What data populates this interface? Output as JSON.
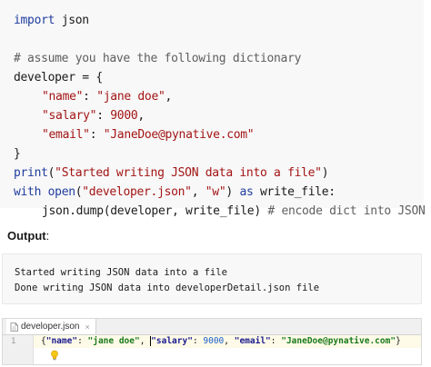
{
  "code": {
    "line1": {
      "kw": "import",
      "rest": " json"
    },
    "line3": "# assume you have the following dictionary",
    "line4": {
      "var": "developer",
      "op": " = {"
    },
    "line5": {
      "key": "\"name\"",
      "sep": ": ",
      "val": "\"jane doe\"",
      "end": ","
    },
    "line6": {
      "key": "\"salary\"",
      "sep": ": ",
      "val": "9000",
      "end": ","
    },
    "line7": {
      "key": "\"email\"",
      "sep": ": ",
      "val": "\"JaneDoe@pynative.com\""
    },
    "line8": "}",
    "line9": {
      "fn": "print",
      "open": "(",
      "str": "\"Started writing JSON data into a file\"",
      "close": ")"
    },
    "line10": {
      "kw1": "with",
      "fn": " open",
      "open": "(",
      "str1": "\"developer.json\"",
      "sep": ", ",
      "str2": "\"w\"",
      "close": ") ",
      "kw2": "as",
      "rest": " write_file:"
    },
    "line11": {
      "call": "json.dump(developer, write_file) ",
      "comment": "# encode dict into JSON"
    }
  },
  "output": {
    "label": "Output",
    "colon": ":",
    "lines": [
      "Started writing JSON data into a file",
      "Done writing JSON data into developerDetail.json file"
    ]
  },
  "editor": {
    "tab_label": "developer.json",
    "tab_close": "×",
    "line_number": "1",
    "json_line": {
      "open": "{",
      "k1": "\"name\"",
      "v1": "\"jane doe\"",
      "k2": "\"salary\"",
      "v2": "9000",
      "k3": "\"email\"",
      "v3": "\"JaneDoe@pynative.com\"",
      "close": "}"
    }
  },
  "colors": {
    "keyword": "#1f3d9e",
    "string": "#a31515",
    "comment": "#5e5e5e",
    "code_bg": "#f8f8f8",
    "json_key": "#1b1b8f",
    "json_string": "#1a7a1a",
    "json_number": "#1b5ec9"
  },
  "icons": [
    "json-file-icon",
    "lightbulb-icon",
    "close-icon"
  ]
}
